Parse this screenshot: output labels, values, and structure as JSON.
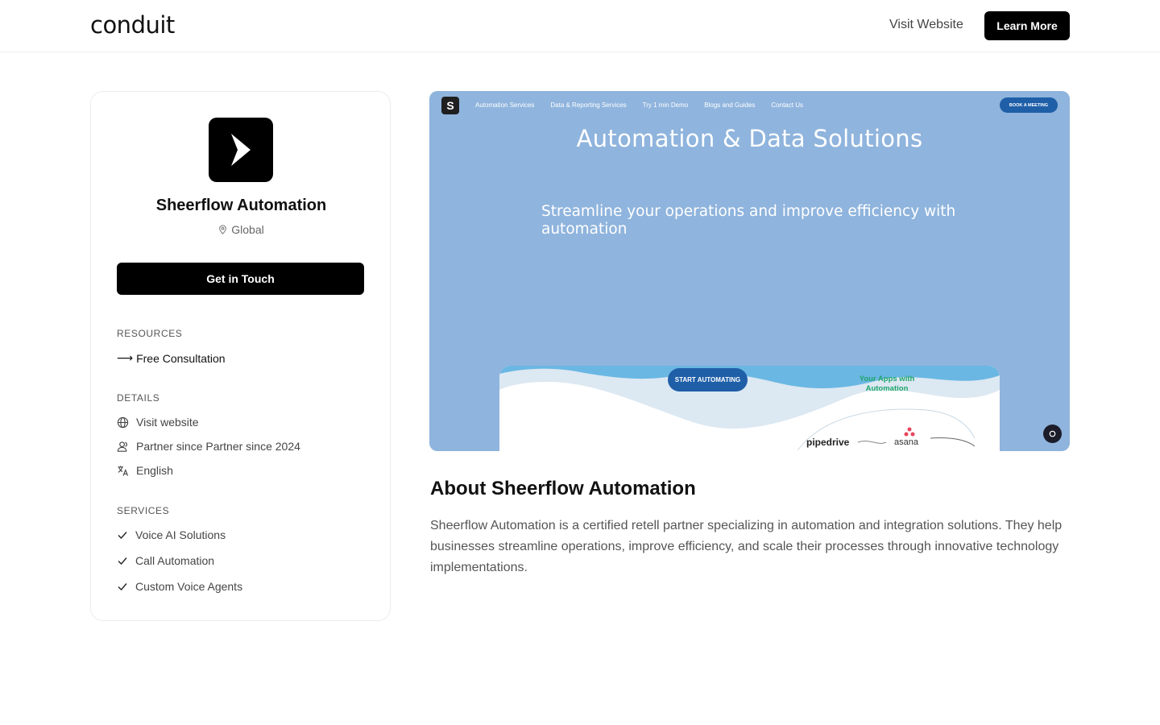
{
  "header": {
    "logo": "conduit",
    "visit_link": "Visit Website",
    "learn_button": "Learn More"
  },
  "partner": {
    "name": "Sheerflow Automation",
    "location": "Global",
    "cta": "Get in Touch",
    "avatar_icon": "chevron-right-icon"
  },
  "resources": {
    "title": "RESOURCES",
    "items": [
      {
        "arrow": "⟶",
        "label": "Free Consultation"
      }
    ]
  },
  "details": {
    "title": "DETAILS",
    "items": [
      {
        "icon": "globe-icon",
        "label": "Visit website"
      },
      {
        "icon": "user-group-icon",
        "label": "Partner since Partner since 2024"
      },
      {
        "icon": "translate-icon",
        "label": "English"
      }
    ]
  },
  "services": {
    "title": "SERVICES",
    "items": [
      {
        "icon": "check-icon",
        "label": "Voice AI Solutions"
      },
      {
        "icon": "check-icon",
        "label": "Call Automation"
      },
      {
        "icon": "check-icon",
        "label": "Custom Voice Agents"
      }
    ]
  },
  "screenshot": {
    "logo_letter": "S",
    "nav": [
      "Automation Services",
      "Data & Reporting Services",
      "Try 1 min Demo",
      "Blogs and Guides",
      "Contact Us"
    ],
    "book_button": "BOOK A MEETING",
    "headline": "Automation & Data  Solutions",
    "subheadline": "Streamline your operations and improve efficiency with automation",
    "start_button": "START AUTOMATING",
    "apps_label": "Your Apps with Automation",
    "app_1": "pipedrive",
    "app_2": "asana",
    "background_color": "#8fb4dd",
    "accent_color": "#1f5fa8"
  },
  "about": {
    "title": "About Sheerflow Automation",
    "text": "Sheerflow Automation is a certified retell partner specializing in automation and integration solutions. They help businesses streamline operations, improve efficiency, and scale their processes through innovative technology implementations."
  }
}
